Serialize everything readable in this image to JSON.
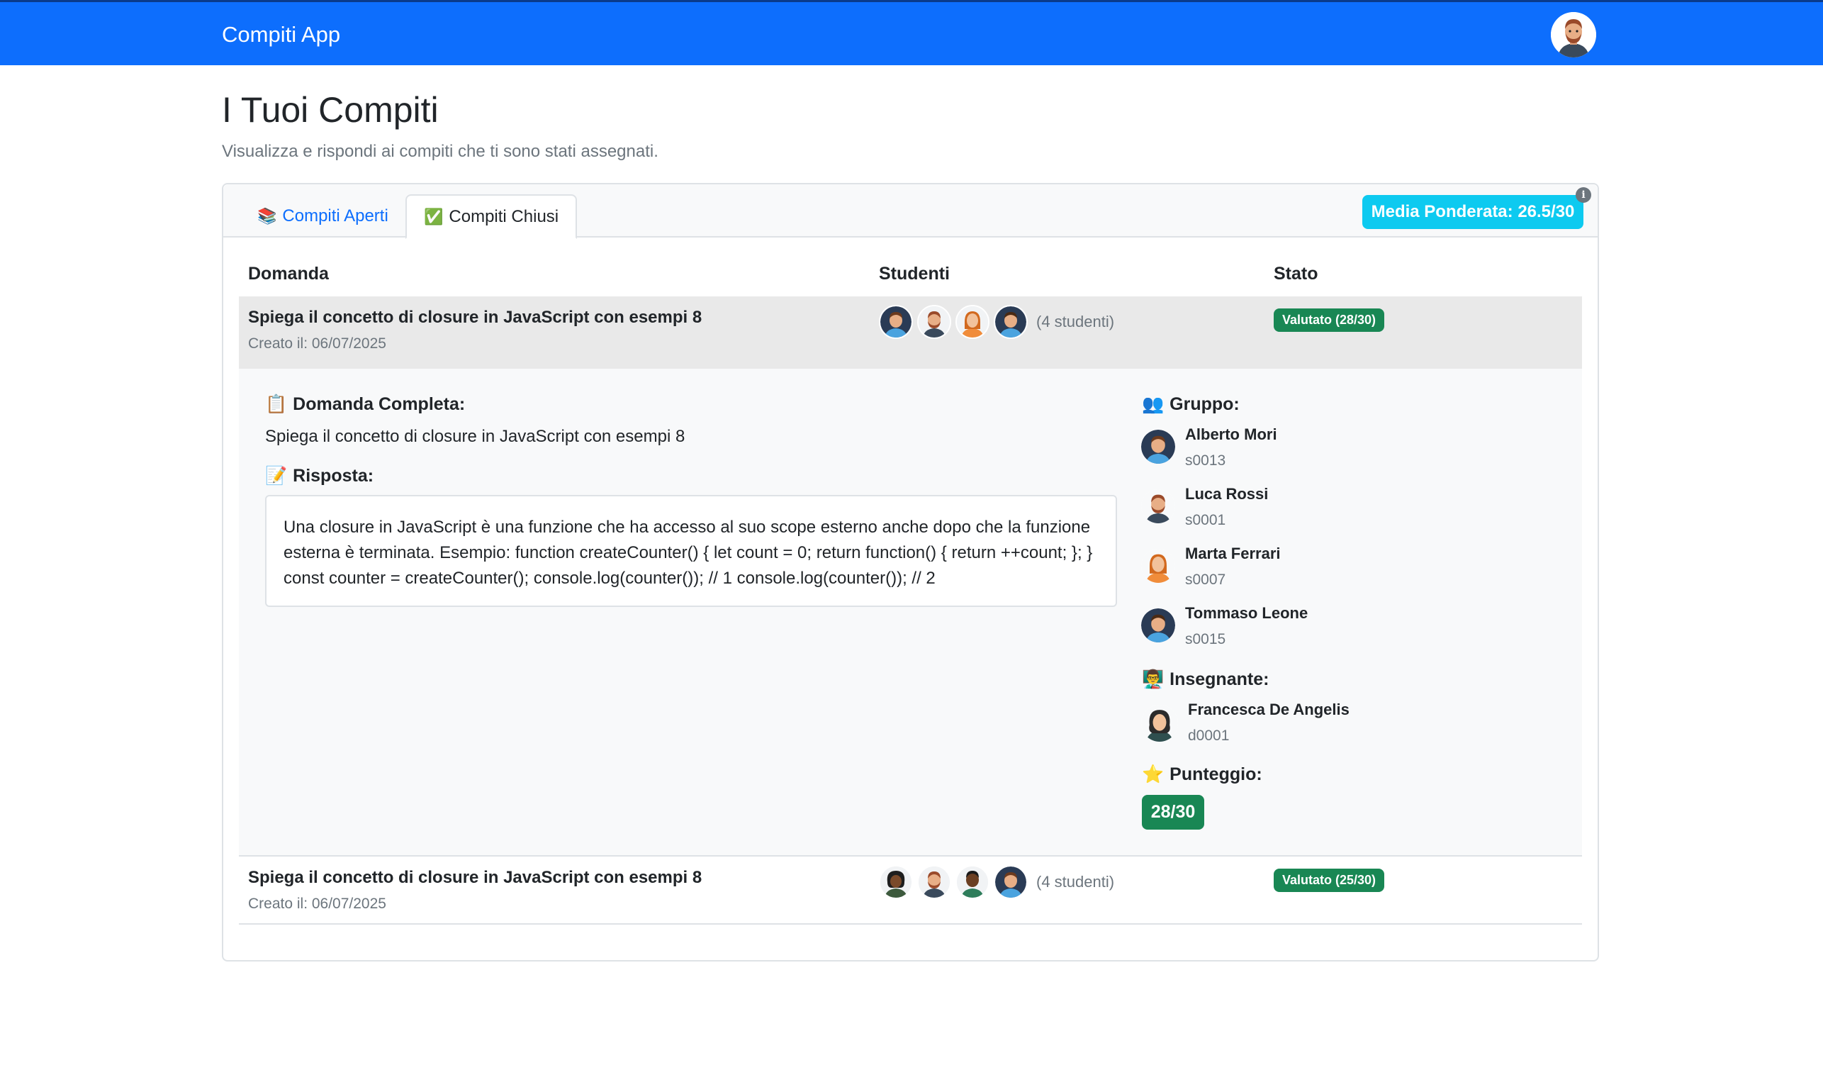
{
  "navbar": {
    "brand": "Compiti App"
  },
  "header": {
    "title": "I Tuoi Compiti",
    "subtitle": "Visualizza e rispondi ai compiti che ti sono stati assegnati."
  },
  "tabs": [
    {
      "icon": "📚",
      "label": "Compiti Aperti"
    },
    {
      "icon": "✅",
      "label": "Compiti Chiusi"
    }
  ],
  "average_badge": "Media Ponderata: 26.5/30",
  "info_icon": "i",
  "table": {
    "headers": [
      "Domanda",
      "Studenti",
      "Stato"
    ],
    "rows": [
      {
        "question": "Spiega il concetto di closure in JavaScript con esempi 8",
        "created": "Creato il: 06/07/2025",
        "students_count": "(4 studenti)",
        "status": "Valutato (28/30)"
      },
      {
        "question": "Spiega il concetto di closure in JavaScript con esempi 8",
        "created": "Creato il: 06/07/2025",
        "students_count": "(4 studenti)",
        "status": "Valutato (25/30)"
      }
    ]
  },
  "details": {
    "full_question_label": "Domanda Completa:",
    "full_question_icon": "📋",
    "full_question": "Spiega il concetto di closure in JavaScript con esempi 8",
    "answer_label": "Risposta:",
    "answer_icon": "📝",
    "answer": "Una closure in JavaScript è una funzione che ha accesso al suo scope esterno anche dopo che la funzione esterna è terminata. Esempio: function createCounter() { let count = 0; return function() { return ++count; }; } const counter = createCounter(); console.log(counter()); // 1 console.log(counter()); // 2",
    "group_label": "Gruppo:",
    "group_icon": "👥",
    "group": [
      {
        "name": "Alberto Mori",
        "id": "s0013"
      },
      {
        "name": "Luca Rossi",
        "id": "s0001"
      },
      {
        "name": "Marta Ferrari",
        "id": "s0007"
      },
      {
        "name": "Tommaso Leone",
        "id": "s0015"
      }
    ],
    "teacher_label": "Insegnante:",
    "teacher_icon": "👨‍🏫",
    "teacher": {
      "name": "Francesca De Angelis",
      "id": "d0001"
    },
    "score_label": "Punteggio:",
    "score_icon": "⭐",
    "score": "28/30"
  },
  "colors": {
    "primary": "#0d6efd",
    "info": "#0dcaf0",
    "success": "#198754",
    "muted": "#6c757d"
  }
}
